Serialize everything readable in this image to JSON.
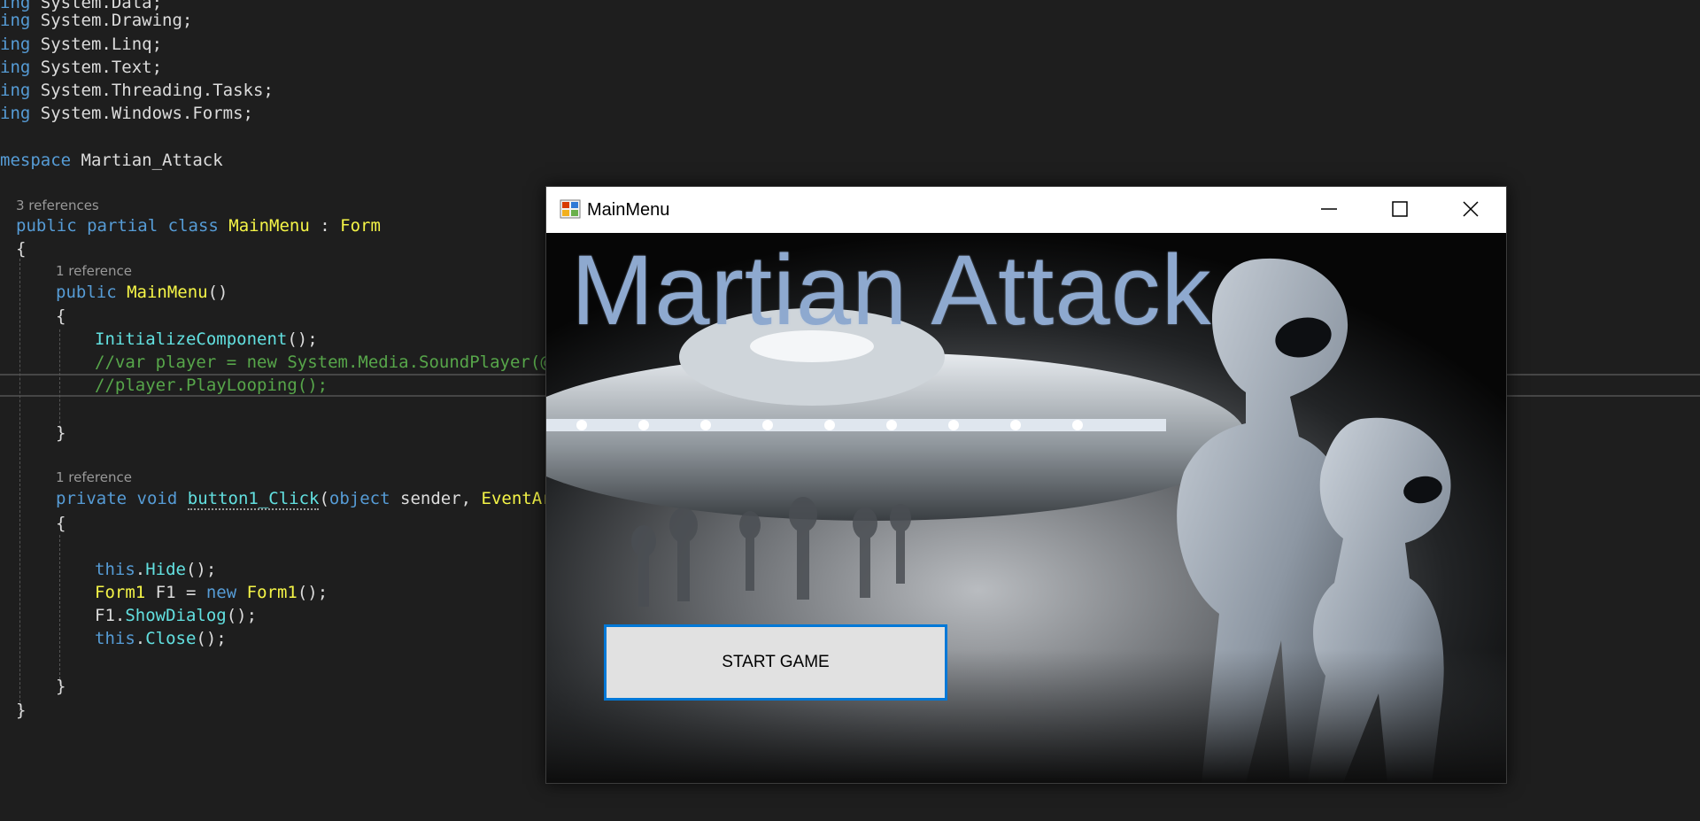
{
  "editor": {
    "code": {
      "l1_kw": "ing",
      "l1_ns": " System.Data;",
      "l2_kw": "ing",
      "l2_ns": " System.Drawing;",
      "l3_kw": "ing",
      "l3_ns": " System.Linq;",
      "l4_kw": "ing",
      "l4_ns": " System.Text;",
      "l5_kw": "ing",
      "l5_ns": " System.Threading.Tasks;",
      "l6_kw": "ing",
      "l6_ns": " System.Windows.Forms;",
      "ns_kw": "mespace",
      "ns_name": " Martian_Attack",
      "lens_class": "3 references",
      "class_public": "public",
      "class_partial": "partial",
      "class_class": "class",
      "class_name": "MainMenu",
      "class_colon": " : ",
      "class_base": "Form",
      "brace_open": "{",
      "lens_ctor": "1 reference",
      "ctor_public": "public",
      "ctor_name": "MainMenu",
      "ctor_parens": "()",
      "ctor_brace_open": "{",
      "init_call": "InitializeComponent",
      "init_end": "();",
      "comment_1": "//var player = new System.Media.SoundPlayer(@\"",
      "comment_2": "//player.PlayLooping();",
      "ctor_brace_close": "}",
      "lens_click": "1 reference",
      "click_private": "private",
      "click_void": "void",
      "click_name": "button1_Click",
      "click_open": "(",
      "click_object": "object",
      "click_sender": " sender, ",
      "click_eventargs": "EventArg",
      "click_brace_open": "{",
      "hide_this": "this",
      "hide_dot": ".",
      "hide_method": "Hide",
      "hide_end": "();",
      "form1_type": "Form1",
      "form1_var": " F1 = ",
      "form1_new": "new",
      "form1_type2": "Form1",
      "form1_end": "();",
      "show_var": "F1.",
      "show_method": "ShowDialog",
      "show_end": "();",
      "close_this": "this",
      "close_dot": ".",
      "close_method": "Close",
      "close_end": "();",
      "click_brace_close": "}",
      "brace_close": "}"
    }
  },
  "window": {
    "title": "MainMenu",
    "controls": {
      "minimize": "minimize-icon",
      "maximize": "maximize-icon",
      "close": "close-icon"
    }
  },
  "game": {
    "title": "Martian Attack",
    "start_button": "START GAME"
  },
  "colors": {
    "editor_background": "#1e1e1e",
    "keyword": "#569cd6",
    "comment": "#57a64a",
    "type_yellow": "#f5f547",
    "method_cyan": "#62e0e0",
    "title_blue": "#8ea9cf",
    "button_border": "#0078d7"
  }
}
